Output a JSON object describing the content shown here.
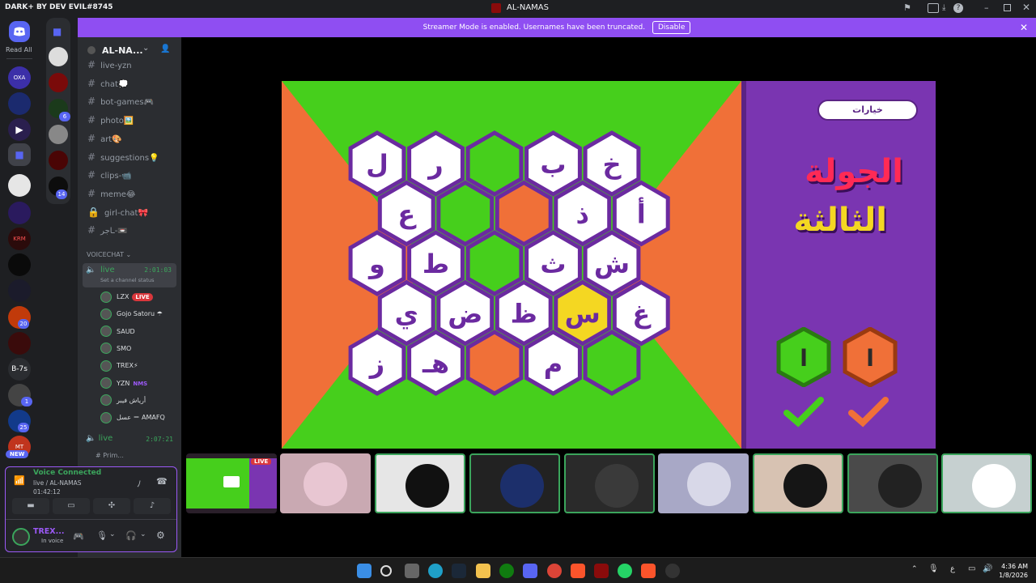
{
  "titlebar": {
    "brand": "DARK+ BY DEV EVIL#8745",
    "title": "AL-NAMAS"
  },
  "rail": {
    "read_all": "Read All",
    "servers": [
      {
        "label": "OXA",
        "badge": ""
      },
      {
        "label": "",
        "badge": ""
      },
      {
        "label": "",
        "badge": ""
      },
      {
        "label": "",
        "badge": ""
      },
      {
        "label": "",
        "badge": ""
      },
      {
        "label": "",
        "badge": ""
      },
      {
        "label": "KRM",
        "badge": ""
      },
      {
        "label": "",
        "badge": ""
      },
      {
        "label": "",
        "badge": ""
      },
      {
        "label": "",
        "badge": "20"
      },
      {
        "label": "",
        "badge": ""
      },
      {
        "label": "B-7s",
        "badge": ""
      },
      {
        "label": "",
        "badge": "1"
      },
      {
        "label": "",
        "badge": "25"
      },
      {
        "label": "MT",
        "badge": ""
      }
    ],
    "new_label": "NEW",
    "folder_badges": [
      "6",
      "14"
    ]
  },
  "banner": {
    "text": "Streamer Mode is enabled. Usernames have been truncated.",
    "disable": "Disable"
  },
  "sidebar": {
    "server_name": "AL-NA...",
    "channels": [
      {
        "name": "live-yzn",
        "type": "text"
      },
      {
        "name": "chat💭",
        "type": "text"
      },
      {
        "name": "bot-games🎮",
        "type": "text"
      },
      {
        "name": "photo🖼️",
        "type": "text"
      },
      {
        "name": "art🎨",
        "type": "text"
      },
      {
        "name": "suggestions💡",
        "type": "text"
      },
      {
        "name": "clips-📹",
        "type": "text"
      },
      {
        "name": "meme😂",
        "type": "text"
      },
      {
        "name": "girl-chat🎀",
        "type": "locked"
      },
      {
        "name": "ـاجر-📼",
        "type": "text"
      }
    ],
    "voice_category": "VOICECHAT",
    "voice_channel": {
      "name": "live",
      "time": "2:01:03",
      "status": "Set a channel status"
    },
    "voice_users": [
      {
        "name": "LZX",
        "live": true
      },
      {
        "name": "Gojo Satoru ☂",
        "live": false
      },
      {
        "name": "SAUD",
        "live": false
      },
      {
        "name": "SMO",
        "live": false
      },
      {
        "name": "TREX⚡",
        "live": false
      },
      {
        "name": "YZN",
        "live": false,
        "tag": "NMS"
      },
      {
        "name": "أرياش فيبر",
        "live": false
      },
      {
        "name": "عسل ＝ AMAFQ",
        "live": false
      }
    ],
    "live_tag": "LIVE",
    "voice_channel_2": {
      "name": "live",
      "time": "2:07:21"
    },
    "voice_channel_3": "# Prim..."
  },
  "voice_panel": {
    "status": "Voice Connected",
    "channel": "live / AL-NAMAS",
    "elapsed": "01:42:12",
    "user": "TREX...",
    "user_status": "In voice"
  },
  "game": {
    "choices_button": "خيارات",
    "round_line1": "الجولة",
    "round_line2": "الثالثة",
    "score_green": "ا",
    "score_orange": "ا",
    "tiles": [
      {
        "t": "ل",
        "c": "white"
      },
      {
        "t": "ر",
        "c": "white"
      },
      {
        "t": "",
        "c": "green"
      },
      {
        "t": "ب",
        "c": "white"
      },
      {
        "t": "خ",
        "c": "white"
      },
      {
        "t": "ع",
        "c": "white"
      },
      {
        "t": "",
        "c": "green"
      },
      {
        "t": "",
        "c": "orange"
      },
      {
        "t": "ذ",
        "c": "white"
      },
      {
        "t": "أ",
        "c": "white"
      },
      {
        "t": "و",
        "c": "white"
      },
      {
        "t": "ط",
        "c": "white"
      },
      {
        "t": "",
        "c": "green"
      },
      {
        "t": "ث",
        "c": "white"
      },
      {
        "t": "ش",
        "c": "white"
      },
      {
        "t": "ي",
        "c": "white"
      },
      {
        "t": "ض",
        "c": "white"
      },
      {
        "t": "ظ",
        "c": "white"
      },
      {
        "t": "س",
        "c": "yellow"
      },
      {
        "t": "غ",
        "c": "white"
      },
      {
        "t": "ز",
        "c": "white"
      },
      {
        "t": "هـ",
        "c": "white"
      },
      {
        "t": "",
        "c": "orange"
      },
      {
        "t": "م",
        "c": "white"
      },
      {
        "t": "",
        "c": "green"
      }
    ]
  },
  "thumbs_live": "LIVE",
  "taskbar": {
    "time": "4:36 AM",
    "date": "1/8/2026",
    "lang": "ع"
  },
  "colors": {
    "green": "#46cf1c",
    "orange": "#f07038",
    "purple": "#7a35b1",
    "yellow": "#f4d722",
    "accent": "#8f4ef2"
  }
}
